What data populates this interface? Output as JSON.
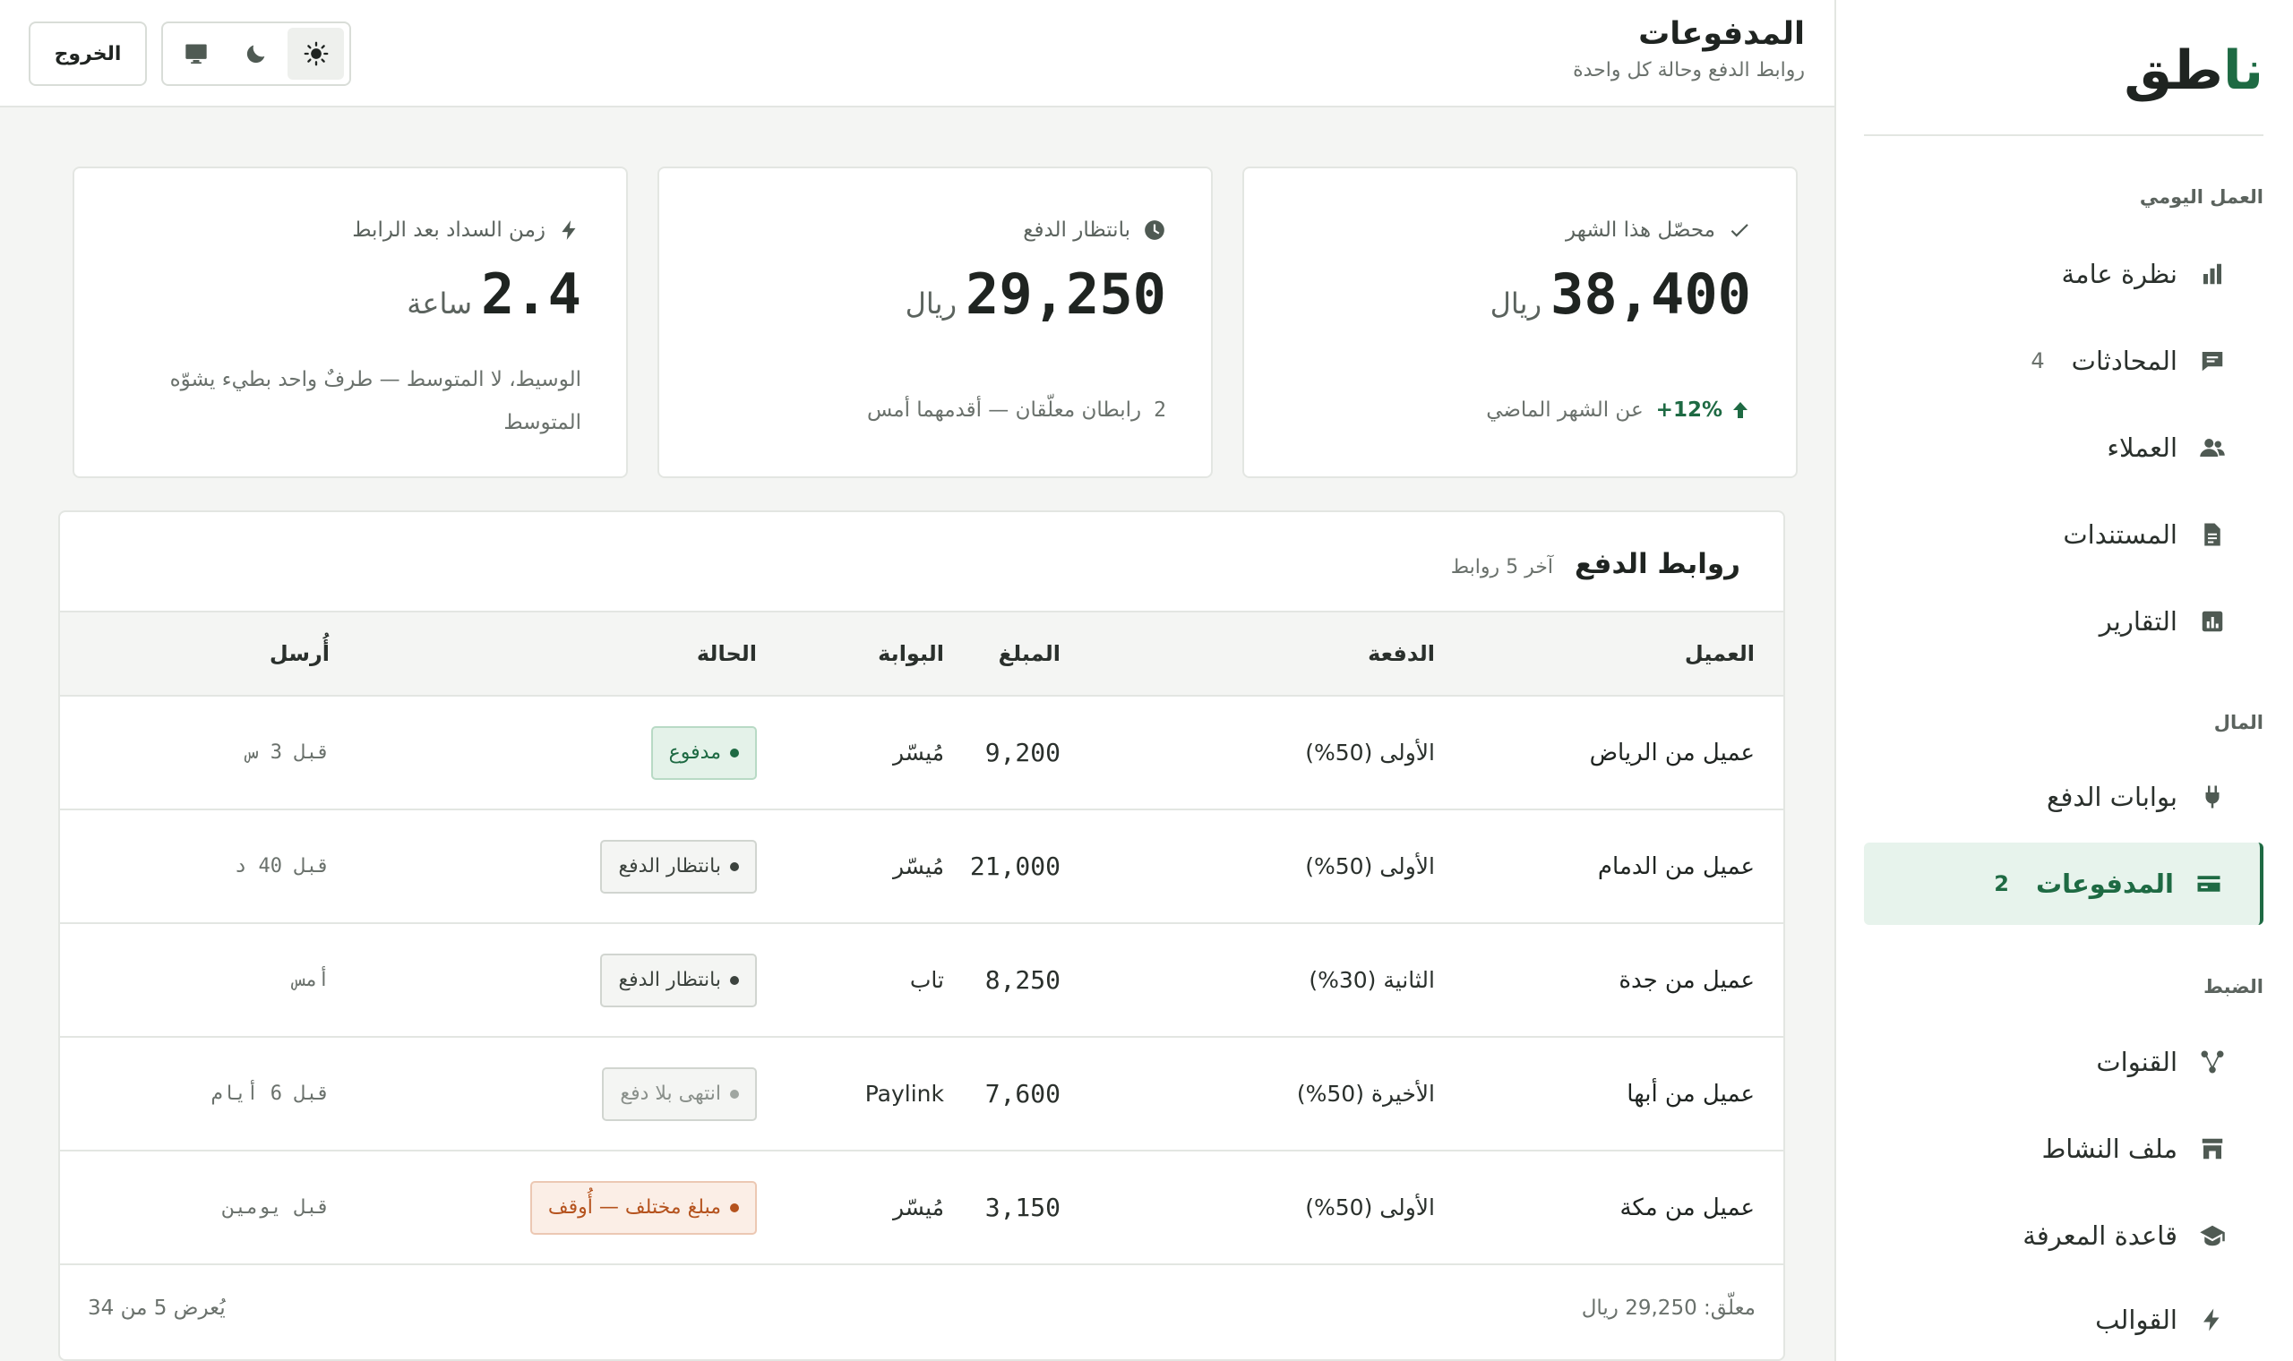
{
  "brand": {
    "name_part1": "نا",
    "name_part2": "طق"
  },
  "sidebar": {
    "sections": [
      {
        "label": "العمل اليومي"
      },
      {
        "label": "المال"
      },
      {
        "label": "الضبط"
      }
    ],
    "items": [
      {
        "label": "نظرة عامة",
        "icon": "bar-chart-icon",
        "count": ""
      },
      {
        "label": "المحادثات",
        "icon": "chat-icon",
        "count": "4"
      },
      {
        "label": "العملاء",
        "icon": "users-icon",
        "count": ""
      },
      {
        "label": "المستندات",
        "icon": "document-icon",
        "count": ""
      },
      {
        "label": "التقارير",
        "icon": "report-icon",
        "count": ""
      },
      {
        "label": "بوابات الدفع",
        "icon": "plug-icon",
        "count": ""
      },
      {
        "label": "المدفوعات",
        "icon": "card-icon",
        "count": "2",
        "active": true
      },
      {
        "label": "القنوات",
        "icon": "channels-icon",
        "count": ""
      },
      {
        "label": "ملف النشاط",
        "icon": "store-icon",
        "count": ""
      },
      {
        "label": "قاعدة المعرفة",
        "icon": "graduation-cap-icon",
        "count": ""
      },
      {
        "label": "القوالب",
        "icon": "bolt-icon",
        "count": ""
      }
    ]
  },
  "header": {
    "title": "المدفوعات",
    "subtitle": "روابط الدفع وحالة كل واحدة",
    "logout_label": "الخروج",
    "theme": {
      "selected": "light",
      "options": [
        "light",
        "dark",
        "system"
      ]
    }
  },
  "stats": [
    {
      "label": "محصّل هذا الشهر",
      "icon": "check-icon",
      "value": "38,400",
      "unit": "ريال",
      "trend": "+12%",
      "foot": "عن الشهر الماضي"
    },
    {
      "label": "بانتظار الدفع",
      "icon": "clock-icon",
      "value": "29,250",
      "unit": "ريال",
      "foot_count": "2",
      "foot": "رابطان معلّقان — أقدمهما أمس"
    },
    {
      "label": "زمن السداد بعد الرابط",
      "icon": "bolt-icon",
      "value": "2.4",
      "unit": "ساعة",
      "foot": "الوسيط، لا المتوسط — طرفٌ واحد بطيء يشوّه المتوسط"
    }
  ],
  "table": {
    "title": "روابط الدفع",
    "subtitle": "آخر 5 روابط",
    "columns": {
      "client": "العميل",
      "installment": "الدفعة",
      "amount": "المبلغ",
      "gateway": "البوابة",
      "status": "الحالة",
      "sent": "أُرسل"
    },
    "rows": [
      {
        "client": "عميل من الرياض",
        "installment": "الأولى (50%)",
        "amount": "9,200",
        "gateway": "مُيسّر",
        "status": "مدفوع",
        "status_type": "paid",
        "sent": "قبل 3 س"
      },
      {
        "client": "عميل من الدمام",
        "installment": "الأولى (50%)",
        "amount": "21,000",
        "gateway": "مُيسّر",
        "status": "بانتظار الدفع",
        "status_type": "pending",
        "sent": "قبل 40 د"
      },
      {
        "client": "عميل من جدة",
        "installment": "الثانية (30%)",
        "amount": "8,250",
        "gateway": "تاب",
        "status": "بانتظار الدفع",
        "status_type": "pending",
        "sent": "أمس"
      },
      {
        "client": "عميل من أبها",
        "installment": "الأخيرة (50%)",
        "amount": "7,600",
        "gateway": "Paylink",
        "status": "انتهى بلا دفع",
        "status_type": "expired",
        "sent": "قبل 6 أيام"
      },
      {
        "client": "عميل من مكة",
        "installment": "الأولى (50%)",
        "amount": "3,150",
        "gateway": "مُيسّر",
        "status": "مبلغ مختلف — أُوقف",
        "status_type": "mismatch",
        "sent": "قبل يومين"
      }
    ],
    "footer": {
      "pending_total": "معلّق: 29,250 ريال",
      "showing": "يُعرض 5 من 34"
    }
  },
  "colors": {
    "accent": "#1e6a43",
    "warning": "#b5531e",
    "background": "#f4f5f3"
  }
}
